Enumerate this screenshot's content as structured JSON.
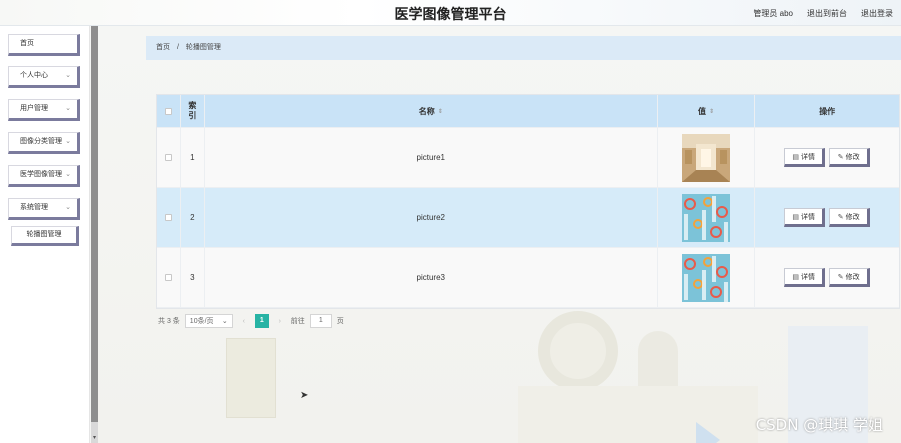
{
  "header": {
    "title": "医学图像管理平台",
    "user": "管理员 abo",
    "to_frontend": "退出到前台",
    "logout": "退出登录"
  },
  "sidebar": {
    "items": [
      {
        "label": "首页",
        "has_chevron": false
      },
      {
        "label": "个人中心",
        "has_chevron": true
      },
      {
        "label": "用户管理",
        "has_chevron": true
      },
      {
        "label": "图像分类管理",
        "has_chevron": true
      },
      {
        "label": "医学图像管理",
        "has_chevron": true
      },
      {
        "label": "系统管理",
        "has_chevron": true
      }
    ],
    "submenu": [
      {
        "label": "轮播图管理"
      }
    ],
    "chevron": "⌄"
  },
  "breadcrumb": {
    "home": "首页",
    "separator": "/",
    "current": "轮播图管理"
  },
  "table": {
    "columns": {
      "index": "索引",
      "name": "名称",
      "value": "值",
      "actions": "操作"
    },
    "rows": [
      {
        "index": "1",
        "name": "picture1",
        "image": "hallway"
      },
      {
        "index": "2",
        "name": "picture2",
        "image": "abstract-shapes"
      },
      {
        "index": "3",
        "name": "picture3",
        "image": "abstract-shapes"
      }
    ],
    "detail_label": "详情",
    "edit_label": "修改"
  },
  "pagination": {
    "total": "共 3 条",
    "page_size": "10条/页",
    "current_page": "1",
    "goto_label": "前往",
    "goto_value": "1",
    "page_suffix": "页"
  },
  "watermark": "CSDN @琪琪 学姐",
  "colors": {
    "header_row": "#c9e3f7",
    "highlight_row": "#d6ebf9",
    "breadcrumb_bg": "#dbeaf7",
    "accent_page": "#27b3a4",
    "button_shadow": "#6f6f8e"
  }
}
